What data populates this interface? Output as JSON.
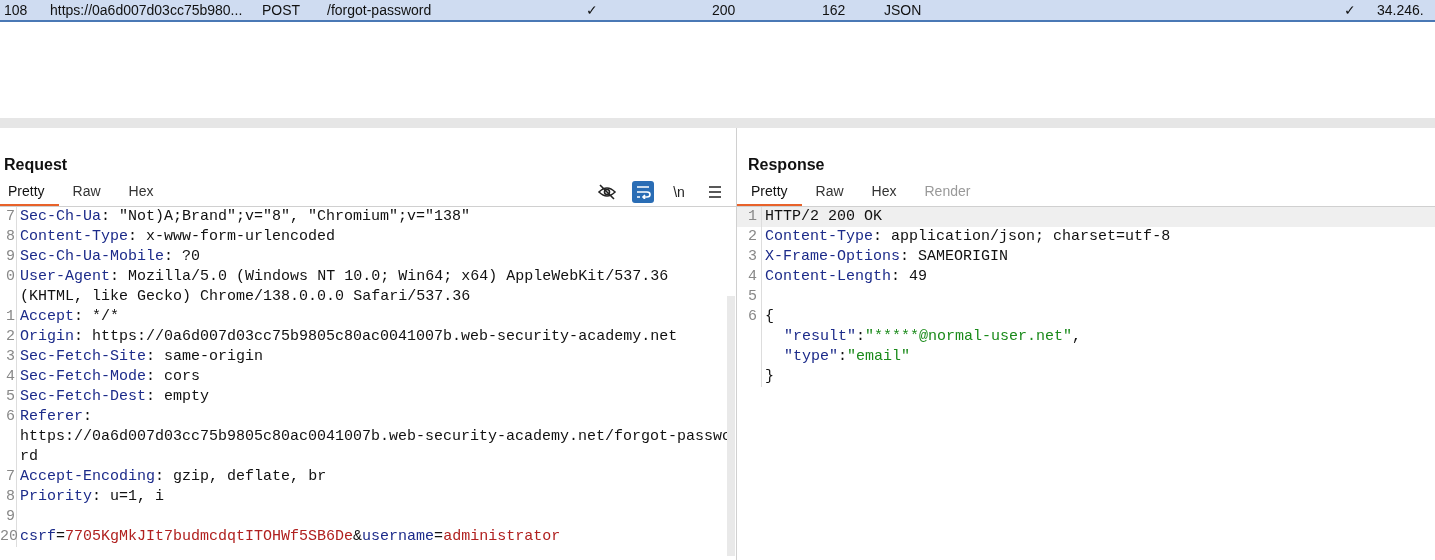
{
  "history_row": {
    "selected": true,
    "cells": [
      "108",
      "https://0a6d007d03cc75b980...",
      "POST",
      "/forgot-password",
      "✓",
      "200",
      "162",
      "JSON",
      "✓",
      "34.246."
    ]
  },
  "request": {
    "title": "Request",
    "tabs": [
      {
        "label": "Pretty",
        "selected": true
      },
      {
        "label": "Raw",
        "selected": false
      },
      {
        "label": "Hex",
        "selected": false
      }
    ],
    "toolbar": [
      {
        "kind": "eye-off",
        "on": false
      },
      {
        "kind": "wrap",
        "on": true
      },
      {
        "kind": "text",
        "label": "\\n",
        "on": false
      },
      {
        "kind": "menu",
        "on": false
      }
    ],
    "lines": [
      {
        "number": "7",
        "parts": [
          {
            "kind": "key",
            "text": "Sec-Ch-Ua"
          },
          {
            "kind": "plain",
            "text": ": \"Not)A;Brand\";v=\"8\", \"Chromium\";v=\"138\""
          }
        ]
      },
      {
        "number": "8",
        "parts": [
          {
            "kind": "key",
            "text": "Content-Type"
          },
          {
            "kind": "plain",
            "text": ": x-www-form-urlencoded"
          }
        ]
      },
      {
        "number": "9",
        "parts": [
          {
            "kind": "key",
            "text": "Sec-Ch-Ua-Mobile"
          },
          {
            "kind": "plain",
            "text": ": ?0"
          }
        ]
      },
      {
        "number": "0",
        "parts": [
          {
            "kind": "key",
            "text": "User-Agent"
          },
          {
            "kind": "plain",
            "text": ": Mozilla/5.0 (Windows NT 10.0; Win64; x64) AppleWebKit/537.36 (KHTML, like Gecko) Chrome/138.0.0.0 Safari/537.36"
          }
        ]
      },
      {
        "number": "1",
        "parts": [
          {
            "kind": "key",
            "text": "Accept"
          },
          {
            "kind": "plain",
            "text": ": */*"
          }
        ]
      },
      {
        "number": "2",
        "parts": [
          {
            "kind": "key",
            "text": "Origin"
          },
          {
            "kind": "plain",
            "text": ": https://0a6d007d03cc75b9805c80ac0041007b.web-security-academy.net"
          }
        ]
      },
      {
        "number": "3",
        "parts": [
          {
            "kind": "key",
            "text": "Sec-Fetch-Site"
          },
          {
            "kind": "plain",
            "text": ": same-origin"
          }
        ]
      },
      {
        "number": "4",
        "parts": [
          {
            "kind": "key",
            "text": "Sec-Fetch-Mode"
          },
          {
            "kind": "plain",
            "text": ": cors"
          }
        ]
      },
      {
        "number": "5",
        "parts": [
          {
            "kind": "key",
            "text": "Sec-Fetch-Dest"
          },
          {
            "kind": "plain",
            "text": ": empty"
          }
        ]
      },
      {
        "number": "6",
        "parts": [
          {
            "kind": "key",
            "text": "Referer"
          },
          {
            "kind": "plain",
            "text": ": https://0a6d007d03cc75b9805c80ac0041007b.web-security-academy.net/forgot-password"
          }
        ]
      },
      {
        "number": "7",
        "parts": [
          {
            "kind": "key",
            "text": "Accept-Encoding"
          },
          {
            "kind": "plain",
            "text": ": gzip, deflate, br"
          }
        ]
      },
      {
        "number": "8",
        "parts": [
          {
            "kind": "key",
            "text": "Priority"
          },
          {
            "kind": "plain",
            "text": ": u=1, i"
          }
        ]
      },
      {
        "number": "9"
      },
      {
        "number": "20",
        "parts": [
          {
            "kind": "key",
            "text": "csrf"
          },
          {
            "kind": "plain",
            "text": "="
          },
          {
            "kind": "param",
            "text": "7705KgMkJIt7budmcdqtITOHWf5SB6De"
          },
          {
            "kind": "plain",
            "text": "&"
          },
          {
            "kind": "key",
            "text": "username"
          },
          {
            "kind": "plain",
            "text": "="
          },
          {
            "kind": "param",
            "text": "administrator"
          }
        ]
      }
    ]
  },
  "response": {
    "title": "Response",
    "tabs": [
      {
        "label": "Pretty",
        "selected": true,
        "disabled": false
      },
      {
        "label": "Raw",
        "selected": false,
        "disabled": false
      },
      {
        "label": "Hex",
        "selected": false,
        "disabled": false
      },
      {
        "label": "Render",
        "selected": false,
        "disabled": true
      }
    ],
    "lines": [
      {
        "number": "1",
        "highlighted": true,
        "parts": [
          {
            "kind": "plain",
            "text": "HTTP/2 200 OK"
          }
        ]
      },
      {
        "number": "2",
        "highlighted": false,
        "parts": [
          {
            "kind": "key",
            "text": "Content-Type"
          },
          {
            "kind": "plain",
            "text": ": application/json; charset=utf-8"
          }
        ]
      },
      {
        "number": "3",
        "highlighted": false,
        "parts": [
          {
            "kind": "key",
            "text": "X-Frame-Options"
          },
          {
            "kind": "plain",
            "text": ": SAMEORIGIN"
          }
        ]
      },
      {
        "number": "4",
        "highlighted": false,
        "parts": [
          {
            "kind": "key",
            "text": "Content-Length"
          },
          {
            "kind": "plain",
            "text": ": 49"
          }
        ]
      },
      {
        "number": "5",
        "highlighted": false
      },
      {
        "number": "6",
        "highlighted": false,
        "parts": [
          {
            "kind": "plain",
            "text": "{"
          }
        ]
      },
      {
        "indent": true,
        "highlighted": false,
        "parts": [
          {
            "kind": "key",
            "text": "\"result\""
          },
          {
            "kind": "plain",
            "text": ":"
          },
          {
            "kind": "string",
            "text": "\"*****@normal-user.net\""
          },
          {
            "kind": "plain",
            "text": ","
          }
        ]
      },
      {
        "indent": true,
        "highlighted": false,
        "parts": [
          {
            "kind": "key",
            "text": "\"type\""
          },
          {
            "kind": "plain",
            "text": ":"
          },
          {
            "kind": "string",
            "text": "\"email\""
          }
        ]
      },
      {
        "highlighted": false,
        "parts": [
          {
            "kind": "plain",
            "text": "}"
          }
        ]
      }
    ]
  }
}
